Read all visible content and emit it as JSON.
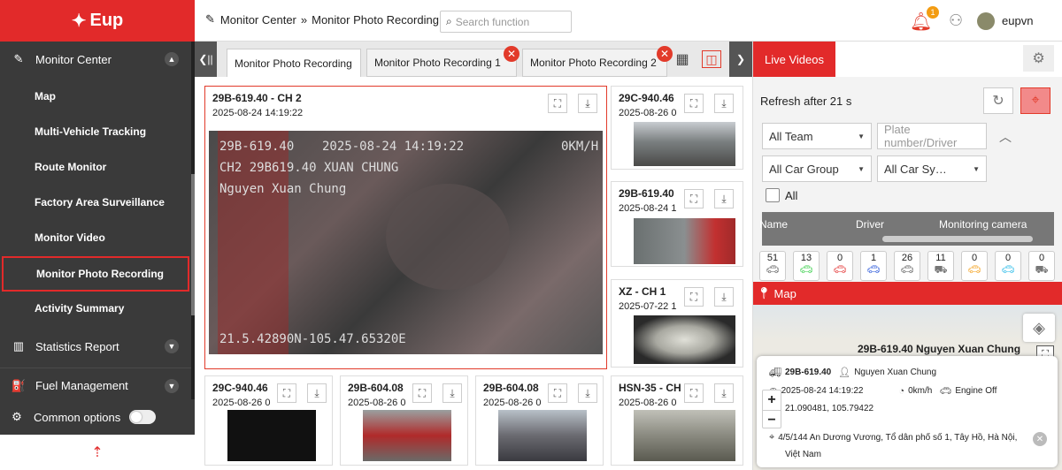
{
  "brand": {
    "logo_text": "Eup"
  },
  "sidebar": {
    "items": [
      {
        "label": "Monitor Center"
      },
      {
        "label": "Map"
      },
      {
        "label": "Multi-Vehicle Tracking"
      },
      {
        "label": "Route Monitor"
      },
      {
        "label": "Factory Area Surveillance"
      },
      {
        "label": "Monitor Video"
      },
      {
        "label": "Monitor Photo Recording"
      },
      {
        "label": "Activity Summary"
      },
      {
        "label": "Statistics Report"
      },
      {
        "label": "Fuel Management"
      }
    ],
    "common_options": "Common options"
  },
  "header": {
    "breadcrumb_1": "Monitor Center",
    "breadcrumb_sep": "»",
    "breadcrumb_2": "Monitor Photo Recording",
    "search_placeholder": "Search function",
    "notification_count": "1",
    "username": "eupvn"
  },
  "tabs": [
    {
      "label": "Monitor Photo Recording"
    },
    {
      "label": "Monitor Photo Recording 1"
    },
    {
      "label": "Monitor Photo Recording 2"
    }
  ],
  "cards": [
    {
      "title": "29B-619.40 - CH 2",
      "date": "2025-08-24 14:19:22",
      "ov1": "29B-619.40",
      "ov2": "2025-08-24 14:19:22",
      "ov3": "0KM/H",
      "ov4": "CH2 29B619.40 XUAN CHUNG",
      "ov5": "Nguyen Xuan Chung",
      "ov6": "21.5.42890N-105.47.65320E"
    },
    {
      "title": "29C-940.46",
      "date": "2025-08-26 0"
    },
    {
      "title": "29B-619.40",
      "date": "2025-08-24 1"
    },
    {
      "title": "XZ - CH 1",
      "date": "2025-07-22 1"
    },
    {
      "title": "29C-940.46",
      "date": "2025-08-26 0"
    },
    {
      "title": "29B-604.08",
      "date": "2025-08-26 0"
    },
    {
      "title": "29B-604.08",
      "date": "2025-08-26 0"
    },
    {
      "title": "HSN-35 - CH",
      "date": "2025-08-26 0"
    }
  ],
  "panel": {
    "live_tab": "Live Videos",
    "refresh": "Refresh after 21 s",
    "team": "All Team",
    "plate_placeholder": "Plate number/Driver",
    "car_group": "All Car Group",
    "car_sys": "All Car Sy…",
    "all": "All",
    "col_name": "Name",
    "col_driver": "Driver",
    "col_camera": "Monitoring camera",
    "stats": [
      {
        "n": "51",
        "color": "#555555"
      },
      {
        "n": "13",
        "color": "#2ecc40"
      },
      {
        "n": "0",
        "color": "#e22a2a"
      },
      {
        "n": "1",
        "color": "#1f4fd8"
      },
      {
        "n": "26",
        "color": "#555555"
      },
      {
        "n": "11",
        "color": "#777777"
      },
      {
        "n": "0",
        "color": "#f39c12"
      },
      {
        "n": "0",
        "color": "#1fb8e8"
      },
      {
        "n": "0",
        "color": "#777777"
      }
    ],
    "map_title": "Map"
  },
  "map": {
    "vehicle_label": "29B-619.40 Nguyen Xuan Chung",
    "plate": "29B-619.40",
    "driver": "Nguyen Xuan Chung",
    "time": "2025-08-24 14:19:22",
    "speed": "0km/h",
    "engine": "Engine Off",
    "coords": "21.090481, 105.79422",
    "address_1": "4/5/144 An Dương Vương, Tổ dân phố số 1, Tây Hồ, Hà Nội,",
    "address_2": "Việt Nam"
  },
  "colors": {
    "brand": "#e22a2a",
    "sidebar": "#3a3a3a"
  }
}
